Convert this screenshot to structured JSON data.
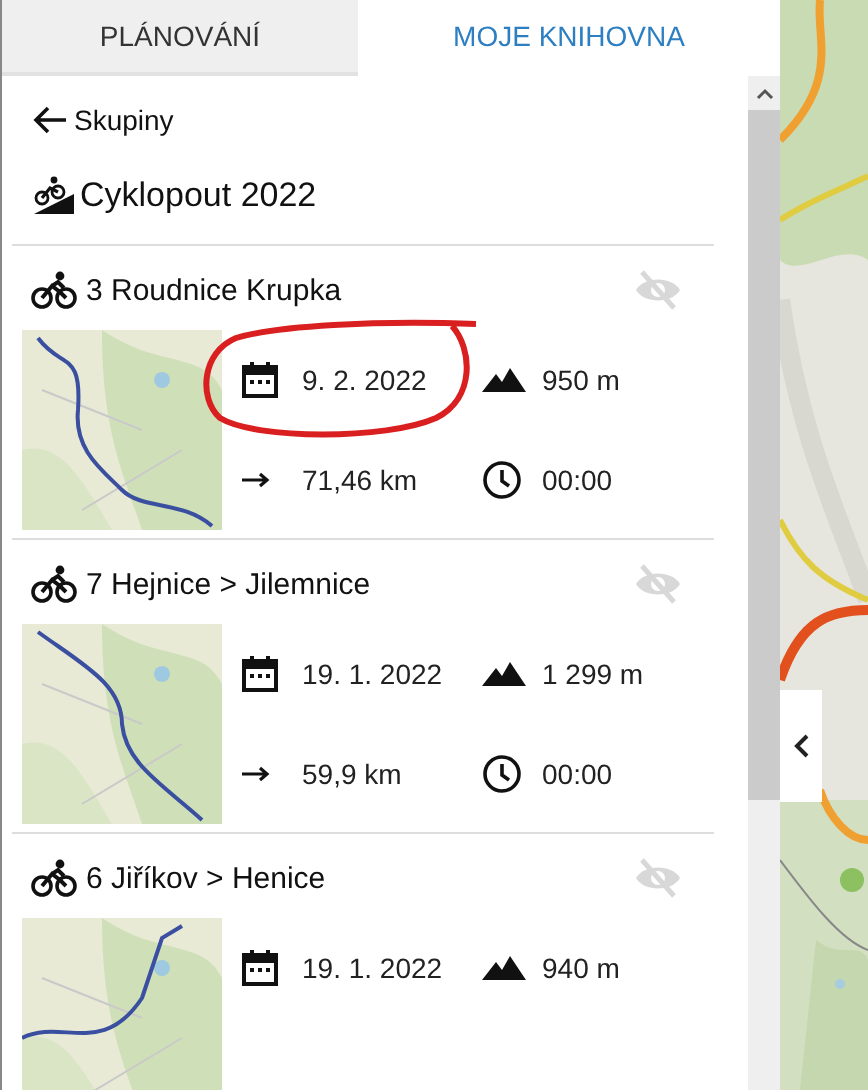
{
  "tabs": [
    {
      "label": "PLÁNOVÁNÍ",
      "selected": false
    },
    {
      "label": "MOJE KNIHOVNA",
      "selected": true
    }
  ],
  "back_link": {
    "label": "Skupiny"
  },
  "group": {
    "title": "Cyklopout 2022"
  },
  "routes": [
    {
      "title": "3 Roudnice Krupka",
      "date": "9. 2. 2022",
      "ascent": "950 m",
      "distance": "71,46 km",
      "duration": "00:00",
      "circled": true
    },
    {
      "title": "7 Hejnice > Jilemnice",
      "date": "19. 1. 2022",
      "ascent": "1 299 m",
      "distance": "59,9 km",
      "duration": "00:00",
      "circled": false
    },
    {
      "title": "6 Jiříkov > Henice",
      "date": "19. 1. 2022",
      "ascent": "940 m",
      "circled": false
    }
  ]
}
